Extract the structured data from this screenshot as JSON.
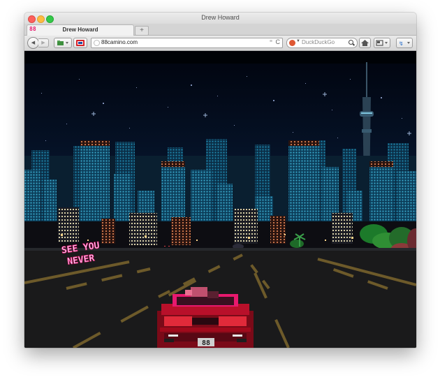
{
  "window": {
    "title": "Drew Howard"
  },
  "tabs": [
    {
      "favicon_text": "88",
      "title": "Drew Howard",
      "active": true
    }
  ],
  "tabbar": {
    "new_tab_label": "+"
  },
  "toolbar": {
    "back_icon": "back-arrow-icon",
    "forward_icon": "forward-arrow-icon",
    "url": "88camino.com",
    "reload_glyph": "C",
    "feed_glyph": "≡",
    "search_placeholder": "DuckDuckGo",
    "search_engine_icon": "duckduckgo-icon"
  },
  "page": {
    "sign_text_1": "SEE YOU",
    "sign_text_2": "NEVER",
    "license_plate": "88",
    "accent_color": "#e8196e",
    "car_color": "#b8102a",
    "road_line_color": "#6d5a2a"
  }
}
